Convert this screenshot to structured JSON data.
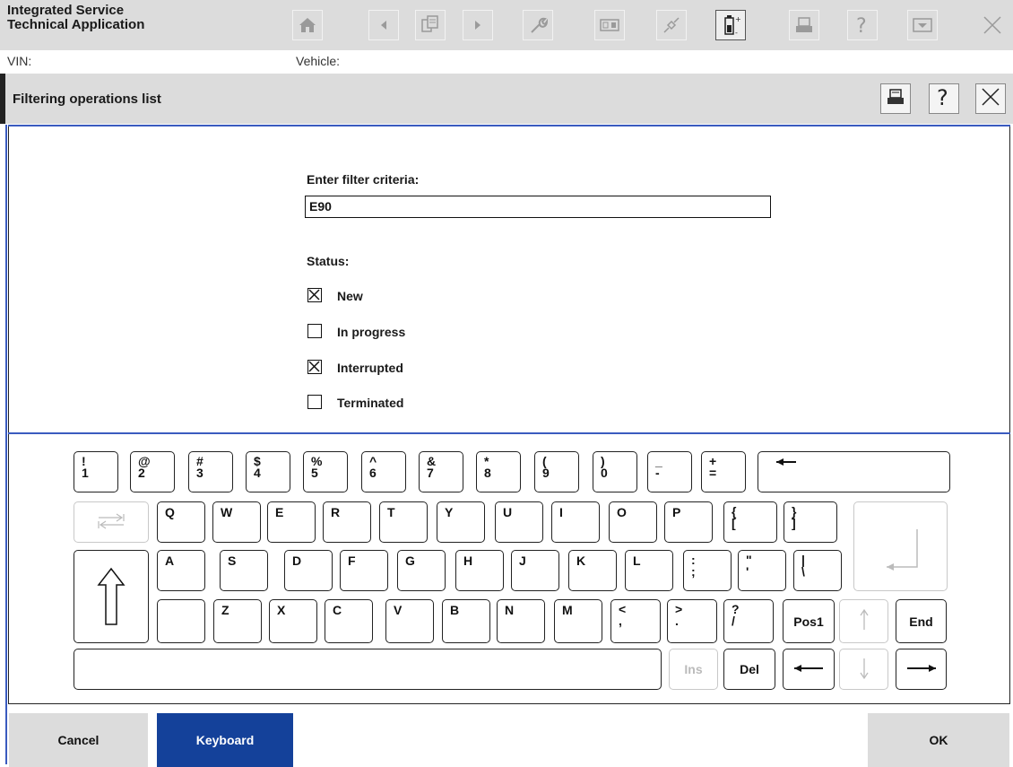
{
  "app": {
    "title_line1": "Integrated Service",
    "title_line2": "Technical Application"
  },
  "vin_bar": {
    "vin_label": "VIN:",
    "vehicle_label": "Vehicle:"
  },
  "dialog": {
    "title": "Filtering operations list"
  },
  "filter": {
    "criteria_label": "Enter filter criteria:",
    "criteria_value": "E90",
    "status_label": "Status:"
  },
  "statuses": [
    {
      "label": "New",
      "checked": true
    },
    {
      "label": "In progress",
      "checked": false
    },
    {
      "label": "Interrupted",
      "checked": true
    },
    {
      "label": "Terminated",
      "checked": false
    }
  ],
  "keyboard": {
    "row1": [
      {
        "top": "!",
        "bottom": "1"
      },
      {
        "top": "@",
        "bottom": "2"
      },
      {
        "top": "#",
        "bottom": "3"
      },
      {
        "top": "$",
        "bottom": "4"
      },
      {
        "top": "%",
        "bottom": "5"
      },
      {
        "top": "^",
        "bottom": "6"
      },
      {
        "top": "&",
        "bottom": "7"
      },
      {
        "top": "*",
        "bottom": "8"
      },
      {
        "top": "(",
        "bottom": "9"
      },
      {
        "top": ")",
        "bottom": "0"
      },
      {
        "top": "_",
        "bottom": "-"
      },
      {
        "top": "+",
        "bottom": "="
      }
    ],
    "row2": [
      "Q",
      "W",
      "E",
      "R",
      "T",
      "Y",
      "U",
      "I",
      "O",
      "P"
    ],
    "row2_extra": [
      {
        "top": "{",
        "bottom": "["
      },
      {
        "top": "}",
        "bottom": "]"
      }
    ],
    "row3": [
      "A",
      "S",
      "D",
      "F",
      "G",
      "H",
      "J",
      "K",
      "L"
    ],
    "row3_extra": [
      {
        "top": ":",
        "bottom": ";"
      },
      {
        "top": "\"",
        "bottom": "'"
      },
      {
        "top": "|",
        "bottom": "\\"
      }
    ],
    "row4": [
      "Z",
      "X",
      "C",
      "V",
      "B",
      "N",
      "M"
    ],
    "row4_extra": [
      {
        "top": "<",
        "bottom": ","
      },
      {
        "top": ">",
        "bottom": "."
      },
      {
        "top": "?",
        "bottom": "/"
      }
    ],
    "pos1": "Pos1",
    "end": "End",
    "ins": "Ins",
    "del": "Del"
  },
  "footer": {
    "cancel": "Cancel",
    "keyboard": "Keyboard",
    "ok": "OK"
  },
  "colors": {
    "accent": "#14419a",
    "panel": "#dcdcdc",
    "rule": "#3a5bbf"
  },
  "icons": [
    "home-icon",
    "back-icon",
    "document-icon",
    "forward-icon",
    "wrench-icon",
    "panel-icon",
    "plug-icon",
    "battery-icon",
    "printer-icon",
    "help-icon",
    "menu-icon",
    "close-icon"
  ]
}
